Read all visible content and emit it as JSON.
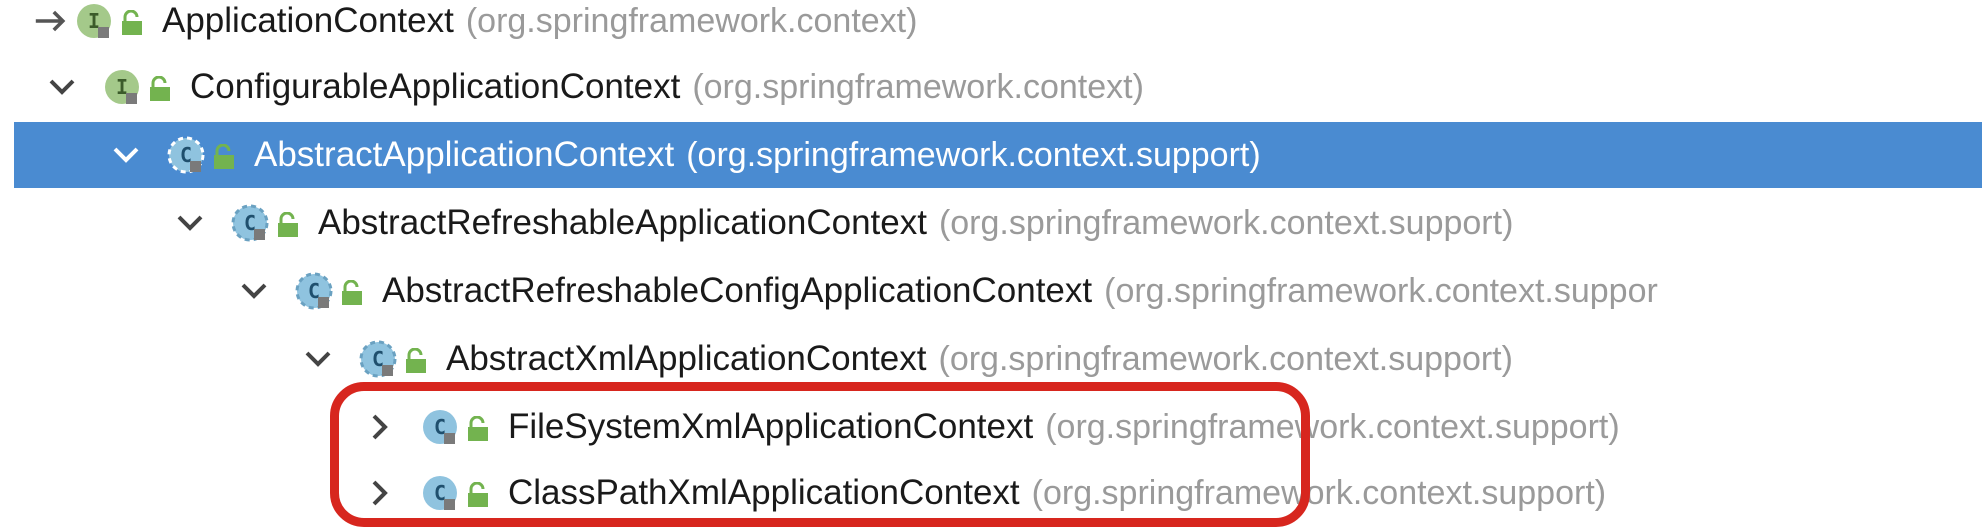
{
  "tree": {
    "items": [
      {
        "name": "ApplicationContext",
        "package": "(org.springframework.context)",
        "kind": "interface",
        "expand_icon": "arrow-right-icon",
        "selected": false
      },
      {
        "name": "ConfigurableApplicationContext",
        "package": "(org.springframework.context)",
        "kind": "interface",
        "expand_icon": "chevron-down-icon",
        "selected": false
      },
      {
        "name": "AbstractApplicationContext",
        "package": "(org.springframework.context.support)",
        "kind": "abstract-class",
        "expand_icon": "chevron-down-icon",
        "selected": true
      },
      {
        "name": "AbstractRefreshableApplicationContext",
        "package": "(org.springframework.context.support)",
        "kind": "abstract-class",
        "expand_icon": "chevron-down-icon",
        "selected": false
      },
      {
        "name": "AbstractRefreshableConfigApplicationContext",
        "package": "(org.springframework.context.suppor",
        "kind": "abstract-class",
        "expand_icon": "chevron-down-icon",
        "selected": false
      },
      {
        "name": "AbstractXmlApplicationContext",
        "package": "(org.springframework.context.support)",
        "kind": "abstract-class",
        "expand_icon": "chevron-down-icon",
        "selected": false
      },
      {
        "name": "FileSystemXmlApplicationContext",
        "package": "(org.springframework.context.support)",
        "kind": "class",
        "expand_icon": "chevron-right-icon",
        "selected": false
      },
      {
        "name": "ClassPathXmlApplicationContext",
        "package": "(org.springframework.context.support)",
        "kind": "class",
        "expand_icon": "chevron-right-icon",
        "selected": false
      }
    ]
  },
  "icons": {
    "interface_letter": "I",
    "class_letter": "C"
  },
  "colors": {
    "selection": "#4a8bd1",
    "highlight_border": "#d7261e",
    "interface_icon": "#a4c98a",
    "class_icon": "#8fc3df",
    "lock_icon": "#73b34f",
    "package_text": "#9a9a9a"
  }
}
